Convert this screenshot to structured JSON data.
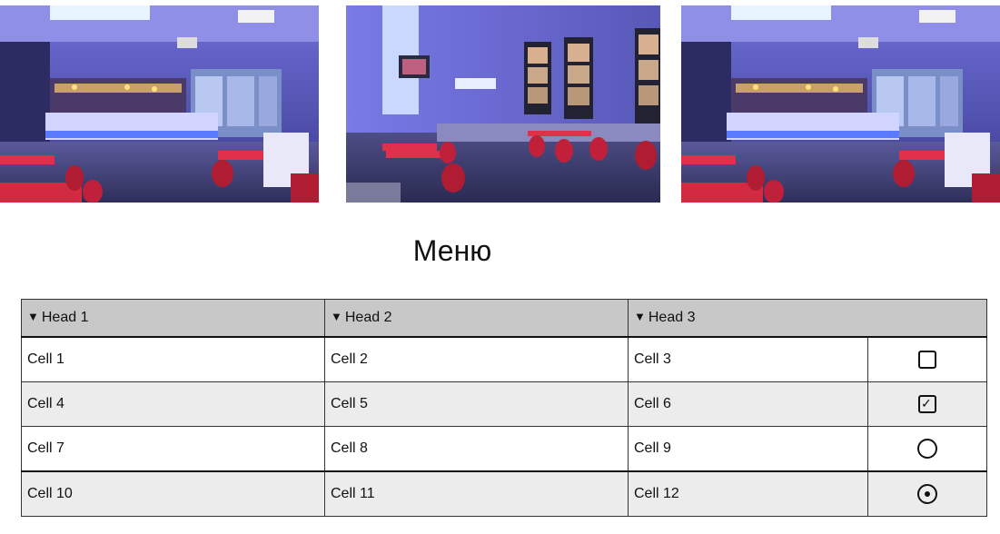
{
  "gallery": {
    "images": [
      {
        "alt": "cafe-bar-interior"
      },
      {
        "alt": "cafe-seating-area"
      },
      {
        "alt": "cafe-bar-interior"
      }
    ]
  },
  "menu": {
    "title": "Меню"
  },
  "table": {
    "headers": [
      "Head 1",
      "Head 2",
      "Head 3",
      ""
    ],
    "sort_glyph": "▼",
    "rows": [
      {
        "cells": [
          "Cell 1",
          "Cell 2",
          "Cell 3"
        ],
        "control": "checkbox",
        "checked": false
      },
      {
        "cells": [
          "Cell 4",
          "Cell 5",
          "Cell 6"
        ],
        "control": "checkbox",
        "checked": true
      },
      {
        "cells": [
          "Cell 7",
          "Cell 8",
          "Cell 9"
        ],
        "control": "radio",
        "checked": false
      },
      {
        "cells": [
          "Cell 10",
          "Cell 11",
          "Cell 12"
        ],
        "control": "radio",
        "checked": true
      }
    ]
  },
  "colors": {
    "header_bg": "#c8c8c8",
    "row_alt_bg": "#ececec"
  }
}
